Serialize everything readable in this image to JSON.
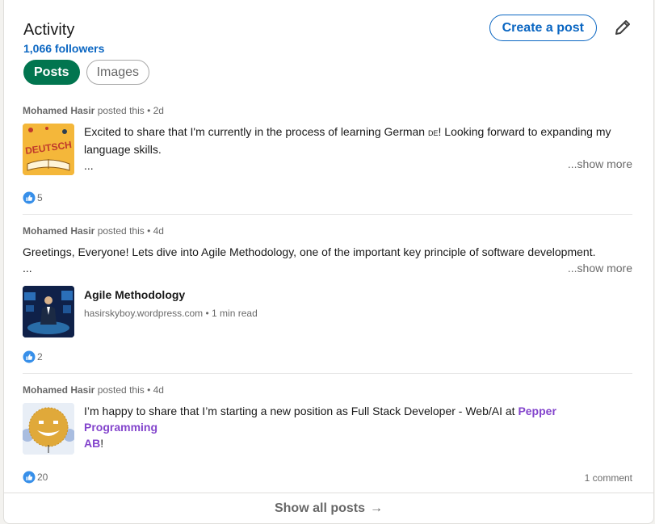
{
  "activity": {
    "title": "Activity",
    "followers": "1,066 followers",
    "create_post_label": "Create a post",
    "tabs": [
      {
        "label": "Posts",
        "active": true
      },
      {
        "label": "Images",
        "active": false
      }
    ]
  },
  "posts": [
    {
      "author": "Mohamed Hasir",
      "action": "posted this",
      "time": "2d",
      "text_line1": "Excited to share that I'm currently in the process of learning German",
      "flag": "DE",
      "text_line1_end": "! Looking forward to expanding my",
      "text_line2": "language skills.",
      "ellipsis": "...",
      "show_more": "...show more",
      "thumb_text": "DEUTSCH",
      "reactions": "5"
    },
    {
      "author": "Mohamed Hasir",
      "action": "posted this",
      "time": "4d",
      "text_line1": "Greetings, Everyone! Lets dive into Agile Methodology, one of the important key principle of software development.",
      "ellipsis": "...",
      "show_more": "...show more",
      "article_title": "Agile Methodology",
      "article_source": "hasirskyboy.wordpress.com",
      "article_read": "1 min read",
      "reactions": "2"
    },
    {
      "author": "Mohamed Hasir",
      "action": "posted this",
      "time": "4d",
      "text_line1": "I’m happy to share that I’m starting a new position as Full Stack Developer - Web/AI at",
      "company_part1": "Pepper Programming",
      "company_part2": "AB",
      "text_end": "!",
      "reactions": "20",
      "comments": "1 comment"
    }
  ],
  "footer": {
    "label": "Show all posts",
    "arrow": "→"
  },
  "colors": {
    "brand_blue": "#0a66c2",
    "active_green": "#01754f",
    "link_purple": "#8344cc"
  }
}
